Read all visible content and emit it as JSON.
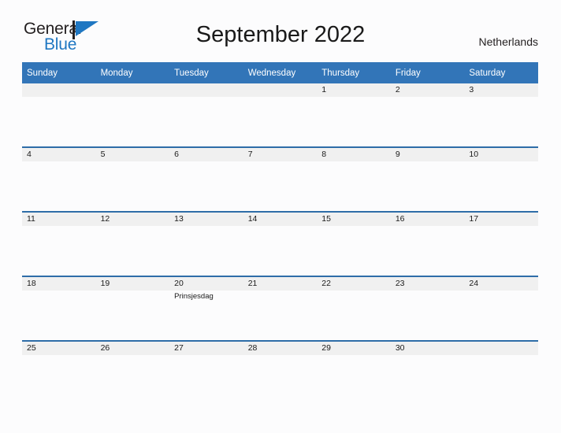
{
  "brand": {
    "word_one": "General",
    "word_two": "Blue",
    "flag_icon": "blue-flag-triangle",
    "accent_color": "#1F77C2"
  },
  "header": {
    "title": "September 2022",
    "country": "Netherlands"
  },
  "theme": {
    "header_blue": "#3275B8",
    "divider_blue": "#2E6DA8",
    "band_gray": "#F0F0F0",
    "page_bg": "#FCFCFD",
    "text": "#1A1A1A"
  },
  "calendar": {
    "weekday_headers": [
      "Sunday",
      "Monday",
      "Tuesday",
      "Wednesday",
      "Thursday",
      "Friday",
      "Saturday"
    ],
    "weeks": [
      [
        {
          "day": "",
          "event": ""
        },
        {
          "day": "",
          "event": ""
        },
        {
          "day": "",
          "event": ""
        },
        {
          "day": "",
          "event": ""
        },
        {
          "day": "1",
          "event": ""
        },
        {
          "day": "2",
          "event": ""
        },
        {
          "day": "3",
          "event": ""
        }
      ],
      [
        {
          "day": "4",
          "event": ""
        },
        {
          "day": "5",
          "event": ""
        },
        {
          "day": "6",
          "event": ""
        },
        {
          "day": "7",
          "event": ""
        },
        {
          "day": "8",
          "event": ""
        },
        {
          "day": "9",
          "event": ""
        },
        {
          "day": "10",
          "event": ""
        }
      ],
      [
        {
          "day": "11",
          "event": ""
        },
        {
          "day": "12",
          "event": ""
        },
        {
          "day": "13",
          "event": ""
        },
        {
          "day": "14",
          "event": ""
        },
        {
          "day": "15",
          "event": ""
        },
        {
          "day": "16",
          "event": ""
        },
        {
          "day": "17",
          "event": ""
        }
      ],
      [
        {
          "day": "18",
          "event": ""
        },
        {
          "day": "19",
          "event": ""
        },
        {
          "day": "20",
          "event": "Prinsjesdag"
        },
        {
          "day": "21",
          "event": ""
        },
        {
          "day": "22",
          "event": ""
        },
        {
          "day": "23",
          "event": ""
        },
        {
          "day": "24",
          "event": ""
        }
      ],
      [
        {
          "day": "25",
          "event": ""
        },
        {
          "day": "26",
          "event": ""
        },
        {
          "day": "27",
          "event": ""
        },
        {
          "day": "28",
          "event": ""
        },
        {
          "day": "29",
          "event": ""
        },
        {
          "day": "30",
          "event": ""
        },
        {
          "day": "",
          "event": ""
        }
      ]
    ]
  }
}
